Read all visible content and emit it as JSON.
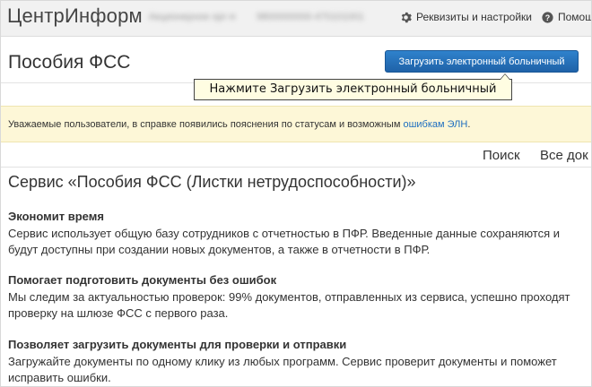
{
  "header": {
    "logo": "ЦентрИнформ",
    "org_name": "Акционерное орг-я",
    "org_inn": "9800000000-470101001",
    "settings_label": "Реквизиты и настройки",
    "help_label": "Помощ"
  },
  "page": {
    "title": "Пособия ФСС",
    "upload_button": "Загрузить электронный больничный",
    "tooltip": "Нажмите Загрузить электронный больничный"
  },
  "notice": {
    "text": "Уважаемые пользователи, в справке появились пояснения по статусам и возможным ",
    "link": "ошибкам ЭЛН",
    "tail": "."
  },
  "tabs": {
    "search": "Поиск",
    "all": "Все док"
  },
  "service": {
    "title": "Сервис «Пособия ФСС (Листки нетрудоспособности)»",
    "blocks": [
      {
        "heading": "Экономит время",
        "text": "Сервис использует общую базу сотрудников с отчетностью в ПФР. Введенные данные сохраняются и будут доступны при создании новых документов, а также в отчетности в ПФР."
      },
      {
        "heading": "Помогает подготовить документы без ошибок",
        "text": "Мы следим за актуальностью проверок: 99% документов, отправленных из сервиса, успешно проходят проверку на шлюзе ФСС с первого раза."
      },
      {
        "heading": "Позволяет загрузить документы для проверки и отправки",
        "text": "Загружайте документы по одному клику из любых программ. Сервис проверит документы и поможет исправить ошибки."
      }
    ]
  },
  "colors": {
    "accent": "#2f82cc",
    "notice_bg": "#fdf7d7",
    "link": "#1f6fc0",
    "tooltip_bg": "#fffde2"
  },
  "icons": {
    "settings": "gear-icon",
    "help": "question-icon"
  }
}
